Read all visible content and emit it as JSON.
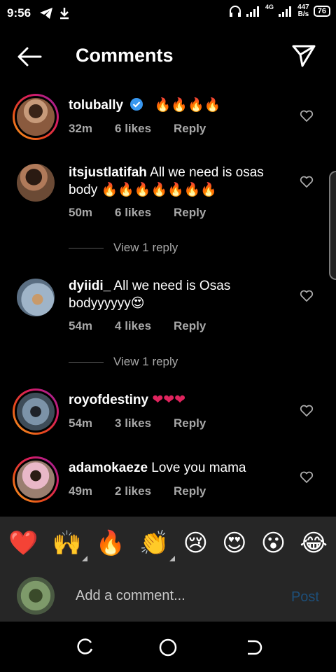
{
  "status_bar": {
    "time": "9:56",
    "network_type": "4G",
    "net_speed_value": "447",
    "net_speed_unit": "B/s",
    "battery": "76"
  },
  "header": {
    "title": "Comments"
  },
  "comments": [
    {
      "username": "tolubally",
      "text": "",
      "emoji": "🔥🔥🔥🔥",
      "verified": true,
      "time": "32m",
      "likes": "6 likes",
      "reply_label": "Reply"
    },
    {
      "username": "itsjustlatifah",
      "text": "All we need is osas body",
      "emoji": "🔥🔥🔥🔥🔥🔥🔥",
      "verified": false,
      "time": "50m",
      "likes": "6 likes",
      "reply_label": "Reply",
      "view_replies": "View 1 reply"
    },
    {
      "username": "dyiidi_",
      "text": "All we need is Osas bodyyyyyy😍",
      "emoji": "",
      "verified": false,
      "time": "54m",
      "likes": "4 likes",
      "reply_label": "Reply",
      "view_replies": "View 1 reply"
    },
    {
      "username": "royofdestiny",
      "text": "",
      "emoji": "❤❤❤",
      "verified": false,
      "time": "54m",
      "likes": "3 likes",
      "reply_label": "Reply"
    },
    {
      "username": "adamokaeze",
      "text": "Love you mama",
      "emoji": "",
      "verified": false,
      "time": "49m",
      "likes": "2 likes",
      "reply_label": "Reply"
    }
  ],
  "emoji_bar": [
    "❤️",
    "🙌",
    "🔥",
    "👏",
    "😢",
    "😍",
    "😮",
    "😂"
  ],
  "comment_input": {
    "placeholder": "Add a comment...",
    "post_label": "Post"
  },
  "colors": {
    "background": "#000000",
    "secondary_text": "#a8a8a8",
    "verified": "#3897f0",
    "post_disabled": "#1d4f7a",
    "panel": "#262626"
  }
}
